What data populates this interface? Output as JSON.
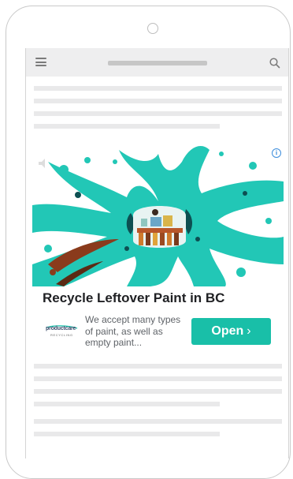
{
  "device": {
    "camera_icon": "camera-circle-icon"
  },
  "browser": {
    "menu_icon": "hamburger-menu-icon",
    "search_icon": "magnifier-search-icon"
  },
  "ad": {
    "headline": "Recycle Leftover Paint in BC",
    "description": "We accept many types of paint, as well as empty paint...",
    "cta_label": "Open",
    "cta_chevron": "›",
    "info_glyph": "i",
    "advertiser_logo": {
      "main_text": "productcare",
      "sub_text": "RECYCLING"
    },
    "colors": {
      "splash": "#22c7b6",
      "cta": "#19bfa8",
      "headline": "#202124",
      "brown_paint": "#8a3b1c"
    }
  }
}
